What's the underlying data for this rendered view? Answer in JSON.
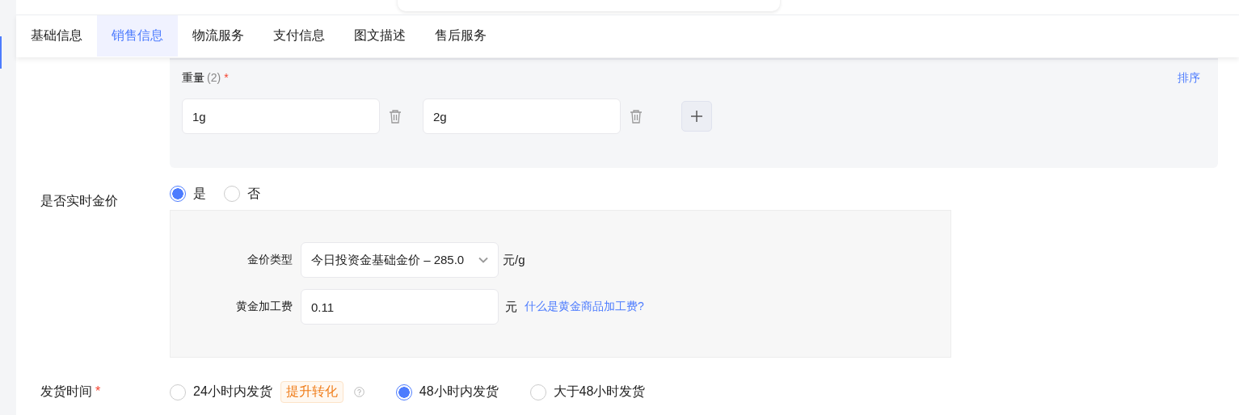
{
  "tabs": [
    {
      "label": "基础信息",
      "selected": false
    },
    {
      "label": "销售信息",
      "selected": true
    },
    {
      "label": "物流服务",
      "selected": false
    },
    {
      "label": "支付信息",
      "selected": false
    },
    {
      "label": "图文描述",
      "selected": false
    },
    {
      "label": "售后服务",
      "selected": false
    }
  ],
  "weight": {
    "label": "重量",
    "count": "(2)",
    "required_mark": "*",
    "sort_link": "排序",
    "values": [
      "1g",
      "2g"
    ]
  },
  "realtime_gold": {
    "label": "是否实时金价",
    "options": [
      {
        "label": "是",
        "selected": true
      },
      {
        "label": "否",
        "selected": false
      }
    ],
    "gold_type": {
      "label": "金价类型",
      "value": "今日投资金基础金价 – 285.0",
      "unit": "元/g"
    },
    "fee": {
      "label": "黄金加工费",
      "value": "0.11",
      "unit": "元",
      "help_link": "什么是黄金商品加工费?"
    }
  },
  "shipping": {
    "label": "发货时间",
    "required_mark": "*",
    "options": [
      {
        "label": "24小时内发货",
        "badge": "提升转化",
        "help": true,
        "selected": false
      },
      {
        "label": "48小时内发货",
        "help": false,
        "selected": true
      },
      {
        "label": "大于48小时发货",
        "help": false,
        "selected": false
      }
    ]
  }
}
